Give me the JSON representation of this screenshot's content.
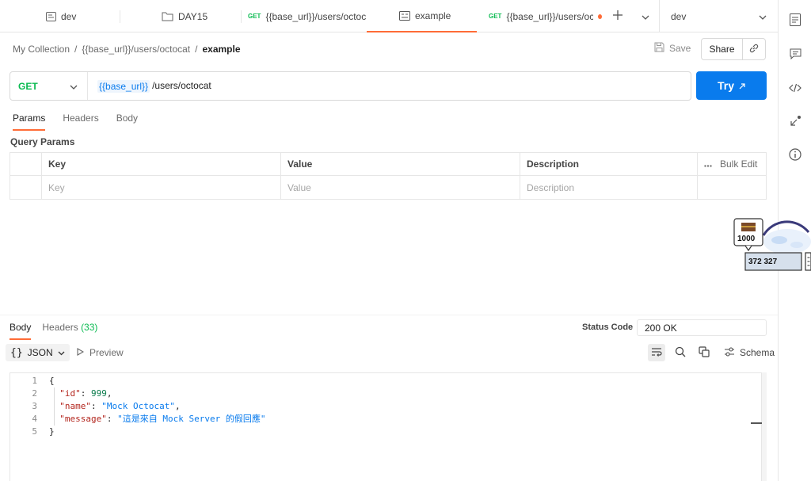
{
  "tabs": [
    {
      "label": "dev",
      "icon": "environment-icon",
      "method": ""
    },
    {
      "label": "DAY15",
      "icon": "collection-icon",
      "method": ""
    },
    {
      "label": "{{base_url}}/users/octoc",
      "icon": "",
      "method": "GET"
    },
    {
      "label": "example",
      "icon": "example-icon",
      "method": ""
    },
    {
      "label": "{{base_url}}/users/octoc",
      "icon": "",
      "method": "GET"
    }
  ],
  "environment": {
    "selected": "dev"
  },
  "breadcrumb": {
    "collection": "My Collection",
    "request": "{{base_url}}/users/octocat",
    "current": "example"
  },
  "actions": {
    "save": "Save",
    "share": "Share"
  },
  "request": {
    "method": "GET",
    "url_var": "{{base_url}}",
    "url_path": "/users/octocat",
    "send": "Try"
  },
  "request_tabs": [
    "Params",
    "Headers",
    "Body"
  ],
  "params": {
    "title": "Query Params",
    "headers": {
      "key": "Key",
      "value": "Value",
      "description": "Description",
      "bulk_edit": "Bulk Edit"
    },
    "placeholders": {
      "key": "Key",
      "value": "Value",
      "description": "Description"
    }
  },
  "widget": {
    "counter": "1000",
    "value": "372 327"
  },
  "response": {
    "tabs": {
      "body": "Body",
      "headers": "Headers",
      "headers_count": "(33)"
    },
    "status_label": "Status Code",
    "status_value": "200 OK",
    "format": "JSON",
    "preview": "Preview",
    "schema": "Schema",
    "lines": [
      {
        "num": "1",
        "text": "{"
      },
      {
        "num": "2",
        "key": "\"id\"",
        "value": "999",
        "type": "number",
        "comma": ","
      },
      {
        "num": "3",
        "key": "\"name\"",
        "value": "\"Mock Octocat\"",
        "type": "string",
        "comma": ","
      },
      {
        "num": "4",
        "key": "\"message\"",
        "value": "\"這是來自 Mock Server 的假回應\"",
        "type": "string",
        "comma": ""
      },
      {
        "num": "5",
        "text": "}"
      }
    ]
  },
  "colors": {
    "accent": "#ff6c37",
    "primary": "#097bed",
    "get": "#0cbb52"
  }
}
